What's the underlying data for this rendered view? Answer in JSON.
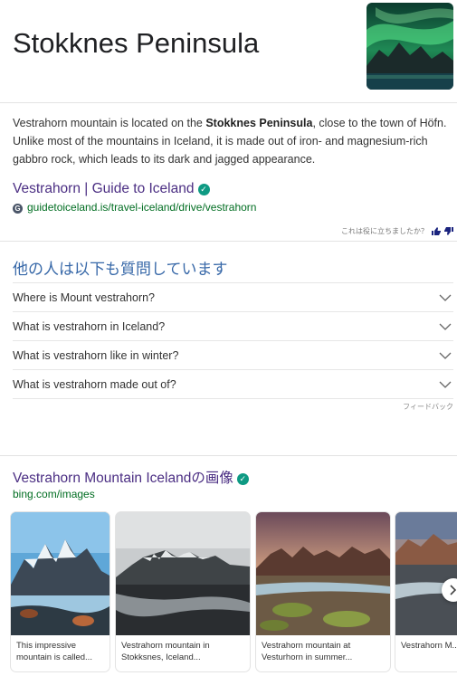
{
  "header": {
    "title": "Stokknes Peninsula"
  },
  "description": {
    "part1": "Vestrahorn mountain is located on the ",
    "bold": "Stokknes Peninsula",
    "part2": ", close to the town of Höfn. Unlike most of the mountains in Iceland, it is made out of iron- and magnesium-rich gabbro rock, which leads to its dark and jagged appearance."
  },
  "source": {
    "title": "Vestrahorn | Guide to Iceland",
    "favicon_letter": "G",
    "url": "guidetoiceland.is/travel-iceland/drive/vestrahorn",
    "helpful_text": "これは役に立ちましたか？"
  },
  "paa": {
    "heading": "他の人は以下も質問しています",
    "questions": [
      "Where is Mount vestrahorn?",
      "What is vestrahorn in Iceland?",
      "What is vestrahorn like in winter?",
      "What is vestrahorn made out of?"
    ],
    "feedback": "フィードバック"
  },
  "images": {
    "title": "Vestrahorn Mountain Icelandの画像",
    "source": "bing.com/images",
    "cards": [
      {
        "caption": "This impressive mountain is called..."
      },
      {
        "caption": "Vestrahorn mountain in Stokksnes, Iceland..."
      },
      {
        "caption": "Vestrahorn mountain at Vesturhorn in summer..."
      },
      {
        "caption": "Vestrahorn M..."
      }
    ]
  },
  "colors": {
    "link": "#4b2e83",
    "url": "#006d21",
    "paa_heading": "#3768a8",
    "verified": "#0e9a83"
  }
}
